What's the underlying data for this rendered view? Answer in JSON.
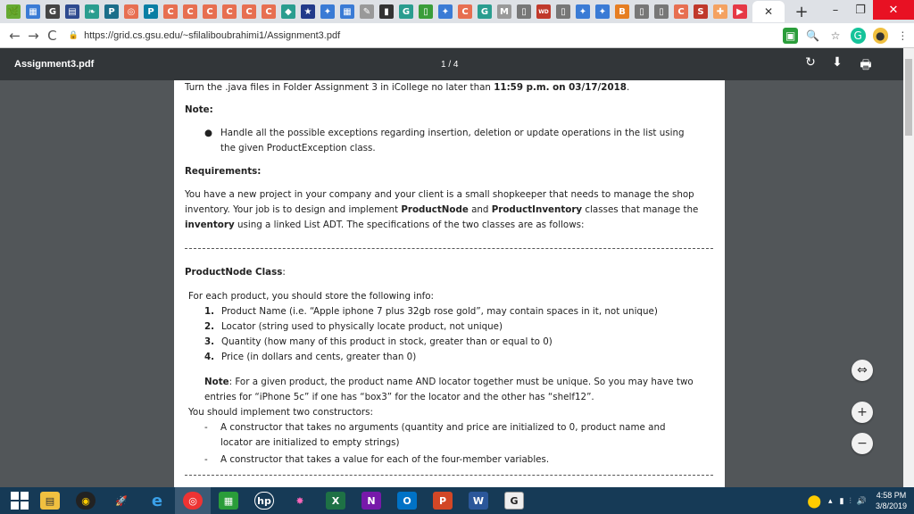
{
  "browser": {
    "tabs": [
      {
        "icon": "tab-favicon",
        "glyph": "🌿",
        "color": "#6a3"
      },
      {
        "icon": "tab-favicon",
        "glyph": "▦",
        "color": "#3a7bd5"
      },
      {
        "icon": "tab-favicon",
        "glyph": "G",
        "color": "#444"
      },
      {
        "icon": "tab-favicon",
        "glyph": "▤",
        "color": "#2e4a8f"
      },
      {
        "icon": "tab-favicon",
        "glyph": "❧",
        "color": "#2a9d8f"
      },
      {
        "icon": "tab-favicon",
        "glyph": "P",
        "color": "#1b6e8a"
      },
      {
        "icon": "tab-favicon",
        "glyph": "◎",
        "color": "#e76f51"
      },
      {
        "icon": "tab-favicon",
        "glyph": "P",
        "color": "#0a7ea4"
      },
      {
        "icon": "tab-favicon",
        "glyph": "C",
        "color": "#e76f51"
      },
      {
        "icon": "tab-favicon",
        "glyph": "C",
        "color": "#e76f51"
      },
      {
        "icon": "tab-favicon",
        "glyph": "C",
        "color": "#e76f51"
      },
      {
        "icon": "tab-favicon",
        "glyph": "C",
        "color": "#e76f51"
      },
      {
        "icon": "tab-favicon",
        "glyph": "C",
        "color": "#e76f51"
      },
      {
        "icon": "tab-favicon",
        "glyph": "C",
        "color": "#e76f51"
      },
      {
        "icon": "tab-favicon",
        "glyph": "◆",
        "color": "#2a9d8f"
      },
      {
        "icon": "tab-favicon",
        "glyph": "★",
        "color": "#223a8a"
      },
      {
        "icon": "tab-favicon",
        "glyph": "✦",
        "color": "#3a7bd5"
      },
      {
        "icon": "tab-favicon",
        "glyph": "▦",
        "color": "#3a7bd5"
      },
      {
        "icon": "tab-favicon",
        "glyph": "✎",
        "color": "#999"
      },
      {
        "icon": "tab-favicon",
        "glyph": "▮",
        "color": "#333"
      },
      {
        "icon": "tab-favicon",
        "glyph": "G",
        "color": "#2a9d8f"
      },
      {
        "icon": "tab-favicon",
        "glyph": "▯",
        "color": "#3a9d3a"
      },
      {
        "icon": "tab-favicon",
        "glyph": "✦",
        "color": "#3a7bd5"
      },
      {
        "icon": "tab-favicon",
        "glyph": "C",
        "color": "#e76f51"
      },
      {
        "icon": "tab-favicon",
        "glyph": "G",
        "color": "#2a9d8f"
      },
      {
        "icon": "tab-favicon",
        "glyph": "M",
        "color": "#999"
      },
      {
        "icon": "tab-favicon",
        "glyph": "▯",
        "color": "#777"
      },
      {
        "icon": "tab-favicon",
        "glyph": "WD",
        "color": "#c0392b"
      },
      {
        "icon": "tab-favicon",
        "glyph": "▯",
        "color": "#777"
      },
      {
        "icon": "tab-favicon",
        "glyph": "✦",
        "color": "#3a7bd5"
      },
      {
        "icon": "tab-favicon",
        "glyph": "✦",
        "color": "#3a7bd5"
      },
      {
        "icon": "tab-favicon",
        "glyph": "B",
        "color": "#e67e22"
      },
      {
        "icon": "tab-favicon",
        "glyph": "▯",
        "color": "#777"
      },
      {
        "icon": "tab-favicon",
        "glyph": "▯",
        "color": "#777"
      },
      {
        "icon": "tab-favicon",
        "glyph": "C",
        "color": "#e76f51"
      },
      {
        "icon": "tab-favicon",
        "glyph": "S",
        "color": "#c0392b"
      },
      {
        "icon": "tab-favicon",
        "glyph": "✚",
        "color": "#f4a261"
      },
      {
        "icon": "tab-favicon",
        "glyph": "▶",
        "color": "#e63946"
      }
    ],
    "active_tab_close": "✕",
    "new_tab": "+",
    "window": {
      "minimize": "–",
      "restore": "❐",
      "close": "✕"
    },
    "url": "https://grid.cs.gsu.edu/~sfilaliboubrahimi1/Assignment3.pdf",
    "back": "←",
    "forward": "→",
    "reload": "C"
  },
  "pdf": {
    "title": "Assignment3.pdf",
    "page_count": "1 / 4",
    "rotate": "↻",
    "download": "⬇",
    "print": "🖶"
  },
  "doc": {
    "l1_pre": "Turn the .java files in Folder Assignment 3 in iCollege no later than ",
    "l1_time": "11:59 p.m.",
    "l1_mid": " on ",
    "l1_date": "03/17/2018",
    "l1_end": ".",
    "note_h": "Note:",
    "note_1a": "Handle all the possible exceptions regarding insertion, deletion or update operations in the list using",
    "note_1b": "the given ProductException class.",
    "req_h": "Requirements:",
    "req_1": "You have a new project in your company and your client is a small shopkeeper that needs to manage the shop",
    "req_2a": "inventory. Your job is to design and implement ",
    "req_2b": "ProductNode",
    "req_2c": "  and ",
    "req_2d": "ProductInventory",
    "req_2e": " classes that manage the",
    "req_3a": "inventory",
    "req_3b": " using a linked List ADT. The specifications of the two classes are as follows:",
    "pn_h": "ProductNode Class",
    "pn_colon": ":",
    "store": "For each product, you should store the following info:",
    "items": [
      {
        "n": "1.",
        "t": "Product Name (i.e. “Apple iphone 7 plus 32gb rose gold”, may contain spaces in it, not unique)"
      },
      {
        "n": "2.",
        "t": "Locator (string used to physically locate product, not unique)"
      },
      {
        "n": "3.",
        "t": "Quantity (how many of this product in stock, greater than or equal to 0)"
      },
      {
        "n": "4.",
        "t": "Price (in dollars and cents, greater than 0)"
      }
    ],
    "note2_h": "Note",
    "note2_a": ": For a given product, the product name AND locator together must be unique. So you may have two",
    "note2_b": "entries for “iPhone 5c” if one has “box3” for the locator and the other has “shelf12”.",
    "ctor": "You should implement two constructors:",
    "c1a": "A constructor that takes no arguments (quantity and price are initialized to 0, product name and",
    "c1b": "locator are initialized to empty strings)",
    "c2": "A constructor that takes a value for each of the four-member variables."
  },
  "taskbar": {
    "time": "4:58 PM",
    "date": "3/8/2019"
  }
}
